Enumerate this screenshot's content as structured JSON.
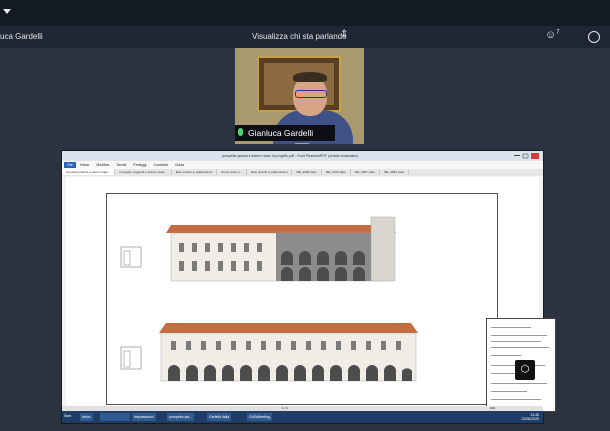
{
  "meeting": {
    "left_label": "uca Gardelli",
    "speaker_view_label": "Visualizza chi sta parlando",
    "speaker_view_arrows": "⇕",
    "participants_icon": "people-icon",
    "participants_count": "7",
    "chat_icon": "chat-icon"
  },
  "speaker": {
    "name": "Gianluca Gardelli",
    "mic_icon": "microphone-icon"
  },
  "cad": {
    "title": "prospetto piazza e interno stato di progetto.pdf - Foxit PhantomPDF (version evaluation)",
    "menu_file": "File",
    "menu_items": [
      "Home",
      "Modifica",
      "Tavole",
      "Proteggi",
      "Condividi",
      "Guida"
    ],
    "tabs": [
      "prospetto piazza e interno stato...",
      "prospetto Legenda e interno stato...",
      "Este umbria 4_elaborazioni",
      "Nuovo sotto p...",
      "Este umbria 4_elaborazioni",
      "ME_4695 stato",
      "ME_4700 stato",
      "ME_4697 stato",
      "ME_4699 stato"
    ],
    "page_indicator": "1 / 1",
    "zoom": "100",
    "colors": {
      "roof": "#c46d43",
      "wall": "#efede6",
      "shade": "#8c8c8c",
      "window": "#7b7b7b"
    }
  },
  "taskbar": {
    "start": "Start",
    "tasks": [
      "Inbox",
      "",
      "",
      "",
      "Impostazioni",
      "prospetto pia...",
      "Cartella italia",
      "GoToMeeting"
    ],
    "time": "13:45",
    "date": "23/06/2020"
  }
}
